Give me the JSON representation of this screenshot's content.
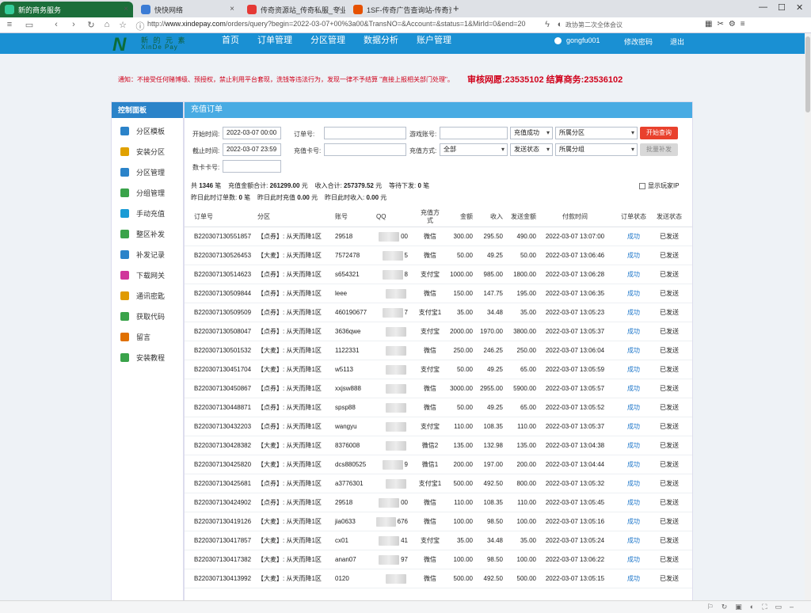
{
  "browser": {
    "tabs": [
      {
        "title": "新的商务服务",
        "icon_color": "#3c9",
        "active": true
      },
      {
        "title": "快快网络",
        "icon_color": "#3a7bd5",
        "active": false
      },
      {
        "title": "传奇资源站_传奇私服_专业的传",
        "icon_color": "#e53935",
        "active": false
      },
      {
        "title": "1SF-传奇广告查询站-传奇资源",
        "icon_color": "#e65100",
        "active": false
      }
    ],
    "url_prefix": "http://",
    "url_domain": "www.xindepay.com",
    "url_rest": "/orders/query?begin=2022-03-07+00%3a00&TransNO=&Account=&status=1&MirId=0&end=20",
    "search_hint": "政协第二次全体会议"
  },
  "header": {
    "logo_letter": "N",
    "logo_text_cn": "新 的 元 素",
    "logo_text_en": "XinDe Pay",
    "nav": [
      "首页",
      "订单管理",
      "分区管理",
      "数据分析",
      "账户管理"
    ],
    "username": "gongfu001",
    "change_password": "修改密码",
    "logout": "退出"
  },
  "notice": {
    "text": "通知：不接受任何赌博级、预授权，禁止利用平台套现，洗钱等违法行为，发现一律不予结算 \"直接上报相关部门处理\"。",
    "strong": "审核网愿:23535102   结算商务:23536102"
  },
  "sidebar": {
    "title": "控制面板",
    "items": [
      {
        "label": "分区模板",
        "color": "#2b83c9"
      },
      {
        "label": "安装分区",
        "color": "#e0a100"
      },
      {
        "label": "分区管理",
        "color": "#2b83c9"
      },
      {
        "label": "分组管理",
        "color": "#3aa34a"
      },
      {
        "label": "手动充值",
        "color": "#1a9bd5"
      },
      {
        "label": "整区补发",
        "color": "#3aa34a"
      },
      {
        "label": "补发记录",
        "color": "#2b83c9"
      },
      {
        "label": "下载网关",
        "color": "#d0359b"
      },
      {
        "label": "通讯密匙",
        "color": "#e09a00"
      },
      {
        "label": "获取代码",
        "color": "#3aa34a"
      },
      {
        "label": "留言",
        "color": "#e07000"
      },
      {
        "label": "安装教程",
        "color": "#3aa34a"
      }
    ]
  },
  "main": {
    "title": "充值订单",
    "filters": {
      "start_label": "开始时间:",
      "start_value": "2022-03-07 00:00",
      "order_label": "订单号:",
      "game_label": "游戏账号:",
      "status_select": "充值成功",
      "zone_select": "所属分区",
      "query_button": "开始查询",
      "end_label": "截止时间:",
      "end_value": "2022-03-07 23:59",
      "card_label": "充值卡号:",
      "method_label": "充值方式:",
      "method_select": "全部",
      "send_select": "发送状态",
      "group_select": "所属分组",
      "batch_button": "批量补发",
      "cardno_label": "数卡卡号:"
    },
    "summary": {
      "total_prefix": "共",
      "total_count": "1346",
      "total_unit": "笔",
      "amount_label": "充值金额合计:",
      "amount_value": "261299.00",
      "amount_unit": "元",
      "income_label": "收入合计:",
      "income_value": "257379.52",
      "income_unit": "元",
      "pending_label": "等待下发:",
      "pending_value": "0",
      "pending_unit": "笔",
      "yday_orders_label": "昨日此时订单数:",
      "yday_orders_value": "0",
      "yday_orders_unit": "笔",
      "yday_recharge_label": "昨日此时充值",
      "yday_recharge_value": "0.00",
      "yday_recharge_unit": "元",
      "yday_income_label": "昨日此时收入:",
      "yday_income_value": "0.00",
      "yday_income_unit": "元",
      "show_ip": "显示玩家IP"
    },
    "columns": [
      "订单号",
      "分区",
      "账号",
      "QQ",
      "充值方式",
      "金额",
      "收入",
      "发送金额",
      "付款时间",
      "订单状态",
      "发送状态"
    ],
    "rows": [
      [
        "B220307130551857",
        "【点券】: 从天而降1区",
        "29518",
        "00",
        "微信",
        "300.00",
        "295.50",
        "490.00",
        "2022-03-07 13:07:00",
        "成功",
        "已发送"
      ],
      [
        "B220307130526453",
        "【大麦】: 从天而降1区",
        "7572478",
        "5",
        "微信",
        "50.00",
        "49.25",
        "50.00",
        "2022-03-07 13:06:46",
        "成功",
        "已发送"
      ],
      [
        "B220307130514623",
        "【点券】: 从天而降1区",
        "s654321",
        "8",
        "支付宝",
        "1000.00",
        "985.00",
        "1800.00",
        "2022-03-07 13:06:28",
        "成功",
        "已发送"
      ],
      [
        "B220307130509844",
        "【点券】: 从天而降1区",
        "leee",
        "",
        "微信",
        "150.00",
        "147.75",
        "195.00",
        "2022-03-07 13:06:35",
        "成功",
        "已发送"
      ],
      [
        "B220307130509509",
        "【点券】: 从天而降1区",
        "460190677",
        "7",
        "支付宝1",
        "35.00",
        "34.48",
        "35.00",
        "2022-03-07 13:05:23",
        "成功",
        "已发送"
      ],
      [
        "B220307130508047",
        "【点券】: 从天而降1区",
        "3636qwe",
        "",
        "支付宝",
        "2000.00",
        "1970.00",
        "3800.00",
        "2022-03-07 13:05:37",
        "成功",
        "已发送"
      ],
      [
        "B220307130501532",
        "【大麦】: 从天而降1区",
        "1122331",
        "",
        "微信",
        "250.00",
        "246.25",
        "250.00",
        "2022-03-07 13:06:04",
        "成功",
        "已发送"
      ],
      [
        "B220307130451704",
        "【大麦】: 从天而降1区",
        "w5113",
        "",
        "支付宝",
        "50.00",
        "49.25",
        "65.00",
        "2022-03-07 13:05:59",
        "成功",
        "已发送"
      ],
      [
        "B220307130450867",
        "【点券】: 从天而降1区",
        "xxjsw888",
        "",
        "微信",
        "3000.00",
        "2955.00",
        "5900.00",
        "2022-03-07 13:05:57",
        "成功",
        "已发送"
      ],
      [
        "B220307130448871",
        "【点券】: 从天而降1区",
        "spsp88",
        "",
        "微信",
        "50.00",
        "49.25",
        "65.00",
        "2022-03-07 13:05:52",
        "成功",
        "已发送"
      ],
      [
        "B220307130432203",
        "【点券】: 从天而降1区",
        "wangyu",
        "",
        "支付宝",
        "110.00",
        "108.35",
        "110.00",
        "2022-03-07 13:05:37",
        "成功",
        "已发送"
      ],
      [
        "B220307130428382",
        "【大麦】: 从天而降1区",
        "8376008",
        "",
        "微信2",
        "135.00",
        "132.98",
        "135.00",
        "2022-03-07 13:04:38",
        "成功",
        "已发送"
      ],
      [
        "B220307130425820",
        "【大麦】: 从天而降1区",
        "dcs880525",
        "9",
        "微信1",
        "200.00",
        "197.00",
        "200.00",
        "2022-03-07 13:04:44",
        "成功",
        "已发送"
      ],
      [
        "B220307130425681",
        "【点券】: 从天而降1区",
        "a3776301",
        "",
        "支付宝1",
        "500.00",
        "492.50",
        "800.00",
        "2022-03-07 13:05:32",
        "成功",
        "已发送"
      ],
      [
        "B220307130424902",
        "【点券】: 从天而降1区",
        "29518",
        "00",
        "微信",
        "110.00",
        "108.35",
        "110.00",
        "2022-03-07 13:05:45",
        "成功",
        "已发送"
      ],
      [
        "B220307130419126",
        "【大麦】: 从天而降1区",
        "jia0633",
        "676",
        "微信",
        "100.00",
        "98.50",
        "100.00",
        "2022-03-07 13:05:16",
        "成功",
        "已发送"
      ],
      [
        "B220307130417857",
        "【大麦】: 从天而降1区",
        "cx01",
        "41",
        "支付宝",
        "35.00",
        "34.48",
        "35.00",
        "2022-03-07 13:05:24",
        "成功",
        "已发送"
      ],
      [
        "B220307130417382",
        "【大麦】: 从天而降1区",
        "anan07",
        "97",
        "微信",
        "100.00",
        "98.50",
        "100.00",
        "2022-03-07 13:06:22",
        "成功",
        "已发送"
      ],
      [
        "B220307130413992",
        "【大麦】: 从天而降1区",
        "0120",
        "",
        "微信",
        "500.00",
        "492.50",
        "500.00",
        "2022-03-07 13:05:15",
        "成功",
        "已发送"
      ]
    ]
  }
}
